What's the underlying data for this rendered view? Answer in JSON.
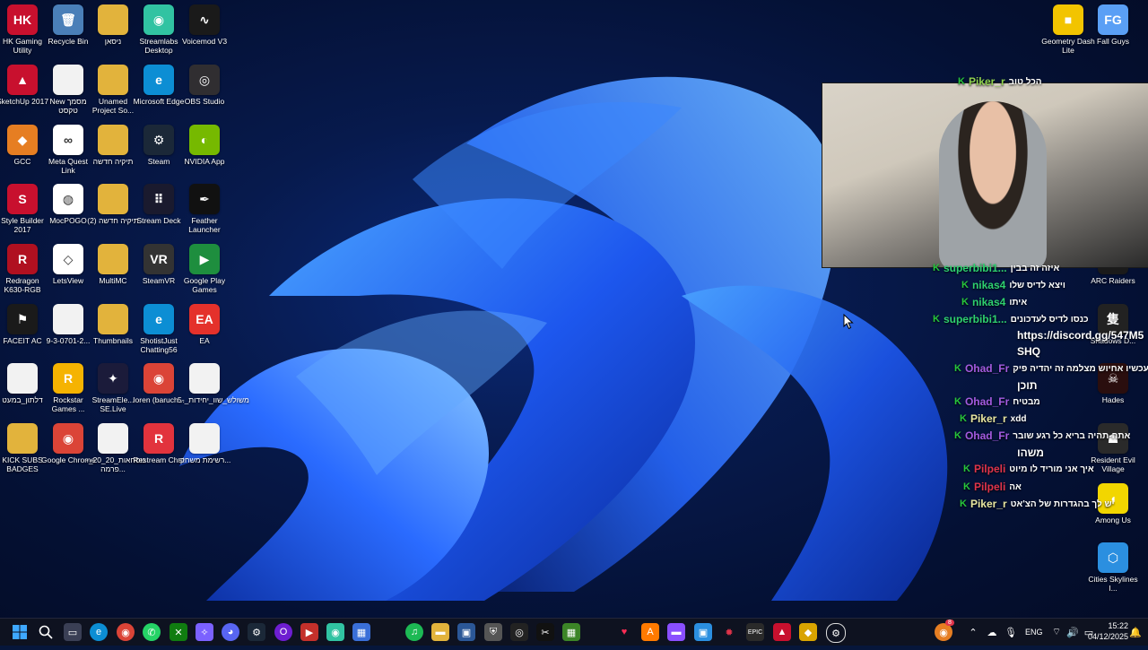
{
  "desktop_icons": [
    {
      "label": "HK Gaming Utility",
      "icon": "hk-gaming-icon",
      "color": "#c8102e",
      "glyph": "HK"
    },
    {
      "label": "Recycle Bin",
      "icon": "recycle-bin-icon",
      "color": "#4a7fb8",
      "glyph": "🗑"
    },
    {
      "label": "ניסאן",
      "icon": "folder-icon",
      "color": "#e2b33c",
      "glyph": ""
    },
    {
      "label": "Streamlabs Desktop",
      "icon": "streamlabs-icon",
      "color": "#31c3a2",
      "glyph": "◉"
    },
    {
      "label": "Voicemod V3",
      "icon": "voicemod-icon",
      "color": "#1a1a1a",
      "glyph": "∿"
    },
    {
      "label": "SketchUp 2017",
      "icon": "sketchup-icon",
      "color": "#c8102e",
      "glyph": "▲"
    },
    {
      "label": "New מסמך טקסט",
      "icon": "text-file-icon",
      "color": "#f2f2f2",
      "glyph": ""
    },
    {
      "label": "Unamed Project So...",
      "icon": "folder-icon",
      "color": "#e2b33c",
      "glyph": ""
    },
    {
      "label": "Microsoft Edge",
      "icon": "edge-icon",
      "color": "#0c8ed4",
      "glyph": "e"
    },
    {
      "label": "OBS Studio",
      "icon": "obs-icon",
      "color": "#302e31",
      "glyph": "◎"
    },
    {
      "label": "GCC",
      "icon": "gcc-icon",
      "color": "#e67e22",
      "glyph": "◆"
    },
    {
      "label": "Meta Quest Link",
      "icon": "meta-icon",
      "color": "#ffffff",
      "glyph": "∞"
    },
    {
      "label": "תיקיה חדשה",
      "icon": "folder-icon",
      "color": "#e2b33c",
      "glyph": ""
    },
    {
      "label": "Steam",
      "icon": "steam-icon",
      "color": "#1b2838",
      "glyph": "⚙"
    },
    {
      "label": "NVIDIA App",
      "icon": "nvidia-icon",
      "color": "#76b900",
      "glyph": "◐"
    },
    {
      "label": "Style Builder 2017",
      "icon": "style-builder-icon",
      "color": "#c8102e",
      "glyph": "S"
    },
    {
      "label": "MocPOGO",
      "icon": "mocpogo-icon",
      "color": "#ffffff",
      "glyph": "◍"
    },
    {
      "label": "תיקיה חדשה (2)",
      "icon": "folder-icon",
      "color": "#e2b33c",
      "glyph": ""
    },
    {
      "label": "Stream Deck",
      "icon": "stream-deck-icon",
      "color": "#1a1a2e",
      "glyph": "⠿"
    },
    {
      "label": "Feather Launcher",
      "icon": "feather-icon",
      "color": "#111111",
      "glyph": "✒"
    },
    {
      "label": "Redragon K630-RGB",
      "icon": "redragon-icon",
      "color": "#b01020",
      "glyph": "R"
    },
    {
      "label": "LetsView",
      "icon": "letsview-icon",
      "color": "#ffffff",
      "glyph": "◇"
    },
    {
      "label": "MultiMC",
      "icon": "folder-icon",
      "color": "#e2b33c",
      "glyph": ""
    },
    {
      "label": "SteamVR",
      "icon": "steamvr-icon",
      "color": "#333333",
      "glyph": "VR"
    },
    {
      "label": "Google Play Games",
      "icon": "google-play-games-icon",
      "color": "#1e8e3e",
      "glyph": "▶"
    },
    {
      "label": "FACEIT AC",
      "icon": "faceit-icon",
      "color": "#1a1a1a",
      "glyph": "⚑"
    },
    {
      "label": "9-3-0701-2...",
      "icon": "document-icon",
      "color": "#f2f2f2",
      "glyph": ""
    },
    {
      "label": "Thumbnails",
      "icon": "folder-icon",
      "color": "#e2b33c",
      "glyph": ""
    },
    {
      "label": "ShotistJust Chatting56",
      "icon": "edge-shortcut-icon",
      "color": "#0c8ed4",
      "glyph": "e"
    },
    {
      "label": "EA",
      "icon": "ea-icon",
      "color": "#e4312b",
      "glyph": "EA"
    },
    {
      "label": "דלתון_במעט",
      "icon": "document-icon",
      "color": "#f2f2f2",
      "glyph": ""
    },
    {
      "label": "Rockstar Games ...",
      "icon": "rockstar-icon",
      "color": "#f5b301",
      "glyph": "R"
    },
    {
      "label": "StreamEle... SE.Live",
      "icon": "streamelements-icon",
      "color": "#1b1b3a",
      "glyph": "✦"
    },
    {
      "label": "Ioren (baruch...",
      "icon": "chrome-icon",
      "color": "#db4437",
      "glyph": "◉"
    },
    {
      "label": "משולש_שוו_יחידות_-5",
      "icon": "document-icon",
      "color": "#f2f2f2",
      "glyph": ""
    },
    {
      "label": "KICK SUBS BADGES",
      "icon": "folder-icon",
      "color": "#e2b33c",
      "glyph": ""
    },
    {
      "label": "Google Chrome",
      "icon": "chrome-icon",
      "color": "#db4437",
      "glyph": "◉"
    },
    {
      "label": "נוסחאות_20_20_-פרמה...",
      "icon": "document-icon",
      "color": "#f2f2f2",
      "glyph": ""
    },
    {
      "label": "Restream Chat",
      "icon": "restream-icon",
      "color": "#e2333d",
      "glyph": "R"
    },
    {
      "label": "רשימת משחקי...",
      "icon": "text-file-icon",
      "color": "#f2f2f2",
      "glyph": ""
    }
  ],
  "right_icons": [
    {
      "label": "Geometry Dash Lite",
      "icon": "geometry-dash-icon",
      "color": "#f2c400",
      "glyph": "■"
    },
    {
      "label": "Fall Guys",
      "icon": "fall-guys-icon",
      "color": "#5a9ff5",
      "glyph": "FG"
    },
    {
      "label": "ARC Raiders",
      "icon": "arc-raiders-icon",
      "color": "#1a1a1a",
      "glyph": "/"
    },
    {
      "label": "Shadows D...",
      "icon": "sekiro-icon",
      "color": "#222222",
      "glyph": "隻"
    },
    {
      "label": "Hades",
      "icon": "hades-icon",
      "color": "#2a0e0e",
      "glyph": "☠"
    },
    {
      "label": "Resident Evil Village",
      "icon": "re-village-icon",
      "color": "#2a2a2a",
      "glyph": "☗"
    },
    {
      "label": "Among Us",
      "icon": "among-us-icon",
      "color": "#f2d600",
      "glyph": "◖"
    },
    {
      "label": "Cities Skylines I...",
      "icon": "cities-icon",
      "color": "#2b8fe0",
      "glyph": "⬡"
    }
  ],
  "chat_overlay": {
    "lines": [
      {
        "user": "Piker_r",
        "user_color": "#8fd14f",
        "text": "הכל טוב"
      },
      {
        "user": "superbibi1...",
        "user_color": "#2ed06f",
        "text": "איזה זה בבין"
      },
      {
        "user": "nikas4",
        "user_color": "#2ed06f",
        "text": "ויצא לדיס שלו"
      },
      {
        "user": "nikas4",
        "user_color": "#2ed06f",
        "text": "איתו"
      },
      {
        "user": "superbibi1...",
        "user_color": "#2ed06f",
        "text": "כנסו לדיס לעדכונים"
      },
      {
        "user": "",
        "user_color": "#ffffff",
        "text": "https://discord.gg/547M5"
      },
      {
        "user": "",
        "user_color": "#ffffff",
        "text": "SHQ"
      },
      {
        "user": "Ohad_Fr",
        "user_color": "#a45be0",
        "text": "עכשיו אחיוש מצלמה זה יהדיה פיק"
      },
      {
        "user": "",
        "user_color": "#ffffff",
        "text": "תוכן"
      },
      {
        "user": "Ohad_Fr",
        "user_color": "#a45be0",
        "text": "מבטיח"
      },
      {
        "user": "Piker_r",
        "user_color": "#e8e6a0",
        "text": "xdd"
      },
      {
        "user": "Ohad_Fr",
        "user_color": "#a45be0",
        "text": "אתה-תהיה בריא כל רגע שובר"
      },
      {
        "user": "",
        "user_color": "#ffffff",
        "text": "משהו"
      },
      {
        "user": "Pilpeli",
        "user_color": "#e0344a",
        "text": "איך אני מוריד לו מיוט"
      },
      {
        "user": "Pilpeli",
        "user_color": "#e0344a",
        "text": "אה"
      },
      {
        "user": "Piker_r",
        "user_color": "#e8e6a0",
        "text": "יש לך בהגדרות של הצ'אט"
      }
    ]
  },
  "taskbar": {
    "language": "ENG",
    "time": "15:22",
    "date": "04/12/2025",
    "notification_count": "8"
  }
}
